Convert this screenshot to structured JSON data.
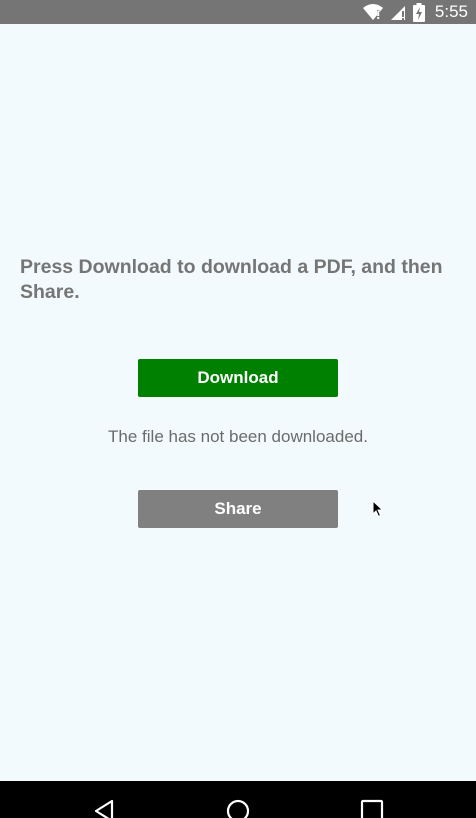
{
  "status_bar": {
    "time": "5:55",
    "icons": [
      "wifi-icon",
      "signal-icon",
      "battery-charging-icon"
    ]
  },
  "main": {
    "instruction": "Press Download to download a PDF, and then Share.",
    "download_label": "Download",
    "status_message": "The file has not been downloaded.",
    "share_label": "Share"
  },
  "nav_bar": {
    "icons": [
      "back-icon",
      "home-icon",
      "recents-icon"
    ]
  },
  "colors": {
    "status_bar": "#757575",
    "background": "#f3fafd",
    "download_button": "#008000",
    "share_button": "#808080",
    "nav_bar": "#000000"
  }
}
